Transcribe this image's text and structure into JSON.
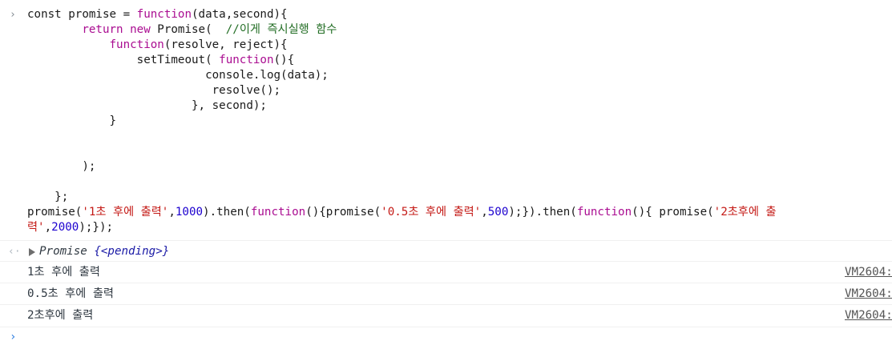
{
  "input": {
    "prompt_symbol": "›",
    "lines": [
      [
        {
          "t": "const promise = "
        },
        {
          "t": "function",
          "c": "kw"
        },
        {
          "t": "(data,second){"
        }
      ],
      [
        {
          "t": "        "
        },
        {
          "t": "return new",
          "c": "kw"
        },
        {
          "t": " Promise(  "
        },
        {
          "t": "//이게 즉시실행 함수",
          "c": "cm"
        }
      ],
      [
        {
          "t": "            "
        },
        {
          "t": "function",
          "c": "kw"
        },
        {
          "t": "(resolve, reject){"
        }
      ],
      [
        {
          "t": "                setTimeout( "
        },
        {
          "t": "function",
          "c": "kw"
        },
        {
          "t": "(){"
        }
      ],
      [
        {
          "t": "                          console.log(data);"
        }
      ],
      [
        {
          "t": "                           resolve();"
        }
      ],
      [
        {
          "t": "                        }, second);"
        }
      ],
      [
        {
          "t": "            }"
        }
      ],
      [
        {
          "t": ""
        }
      ],
      [
        {
          "t": ""
        }
      ],
      [
        {
          "t": "        );"
        }
      ],
      [
        {
          "t": ""
        }
      ],
      [
        {
          "t": "    };"
        }
      ],
      [
        {
          "t": "promise("
        },
        {
          "t": "'1초 후에 출력'",
          "c": "str"
        },
        {
          "t": ","
        },
        {
          "t": "1000",
          "c": "num"
        },
        {
          "t": ").then("
        },
        {
          "t": "function",
          "c": "kw"
        },
        {
          "t": "(){promise("
        },
        {
          "t": "'0.5초 후에 출력'",
          "c": "str"
        },
        {
          "t": ","
        },
        {
          "t": "500",
          "c": "num"
        },
        {
          "t": ");}).then("
        },
        {
          "t": "function",
          "c": "kw"
        },
        {
          "t": "(){ promise("
        },
        {
          "t": "'2초후에 출",
          "c": "str"
        }
      ],
      [
        {
          "t": "력'",
          "c": "str"
        },
        {
          "t": ","
        },
        {
          "t": "2000",
          "c": "num"
        },
        {
          "t": ");});"
        }
      ]
    ]
  },
  "result": {
    "icon": "‹·",
    "type_label": "Promise",
    "state_label": "{<pending>}"
  },
  "logs": [
    {
      "text": "1초 후에 출력",
      "source": "VM2604:"
    },
    {
      "text": "0.5초 후에 출력",
      "source": "VM2604:"
    },
    {
      "text": "2초후에 출력",
      "source": "VM2604:"
    }
  ],
  "bottom_prompt": "›",
  "colors": {
    "keyword": "#aa0d91",
    "comment": "#236e25",
    "string": "#c41a16",
    "number": "#1c00cf",
    "prompt": "#2e7ee0"
  }
}
